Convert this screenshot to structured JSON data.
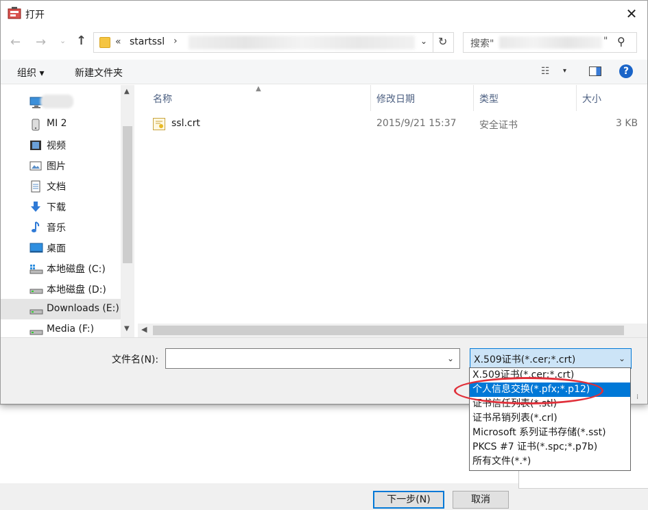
{
  "dialog": {
    "title": "打开",
    "close_glyph": "✕"
  },
  "address_bar": {
    "chevron": "«",
    "crumb": "startssl",
    "separator": "›",
    "dropdown_glyph": "⌄",
    "refresh_glyph": "↻"
  },
  "search": {
    "prefix": "搜索\"",
    "suffix": "\"",
    "icon": "search-icon"
  },
  "toolbar": {
    "organize_label": "组织 ▾",
    "new_folder_label": "新建文件夹",
    "view_glyph": "☷",
    "view_dropdown_glyph": "▾",
    "help_glyph": "?"
  },
  "nav": {
    "items": [
      {
        "label": "",
        "icon": "computer-icon"
      },
      {
        "label": "MI 2",
        "icon": "phone-icon"
      },
      {
        "label": "视频",
        "icon": "video-icon"
      },
      {
        "label": "图片",
        "icon": "pictures-icon"
      },
      {
        "label": "文档",
        "icon": "documents-icon"
      },
      {
        "label": "下载",
        "icon": "download-icon"
      },
      {
        "label": "音乐",
        "icon": "music-icon"
      },
      {
        "label": "桌面",
        "icon": "desktop-icon"
      },
      {
        "label": "本地磁盘 (C:)",
        "icon": "system-drive-icon"
      },
      {
        "label": "本地磁盘 (D:)",
        "icon": "drive-icon"
      },
      {
        "label": "Downloads (E:)",
        "icon": "drive-icon"
      },
      {
        "label": "Media (F:)",
        "icon": "drive-icon"
      }
    ]
  },
  "file_list": {
    "columns": [
      "名称",
      "修改日期",
      "类型",
      "大小"
    ],
    "rows": [
      {
        "name": "ssl.crt",
        "modified": "2015/9/21 15:37",
        "type": "安全证书",
        "size": "3 KB"
      }
    ]
  },
  "bottom": {
    "filename_label": "文件名(N):",
    "filename_value": "",
    "filetype_selected": "X.509证书(*.cer;*.crt)",
    "filetype_options": [
      "X.509证书(*.cer;*.crt)",
      "个人信息交换(*.pfx;*.p12)",
      "证书信任列表(*.stl)",
      "证书吊销列表(*.crl)",
      "Microsoft 系列证书存储(*.sst)",
      "PKCS #7 证书(*.spc;*.p7b)",
      "所有文件(*.*)"
    ],
    "highlighted_index": 1
  },
  "wizard": {
    "next_label": "下一步(N)",
    "cancel_label": "取消"
  },
  "colors": {
    "accent": "#0078d7",
    "annotation_red": "#e0303a"
  }
}
